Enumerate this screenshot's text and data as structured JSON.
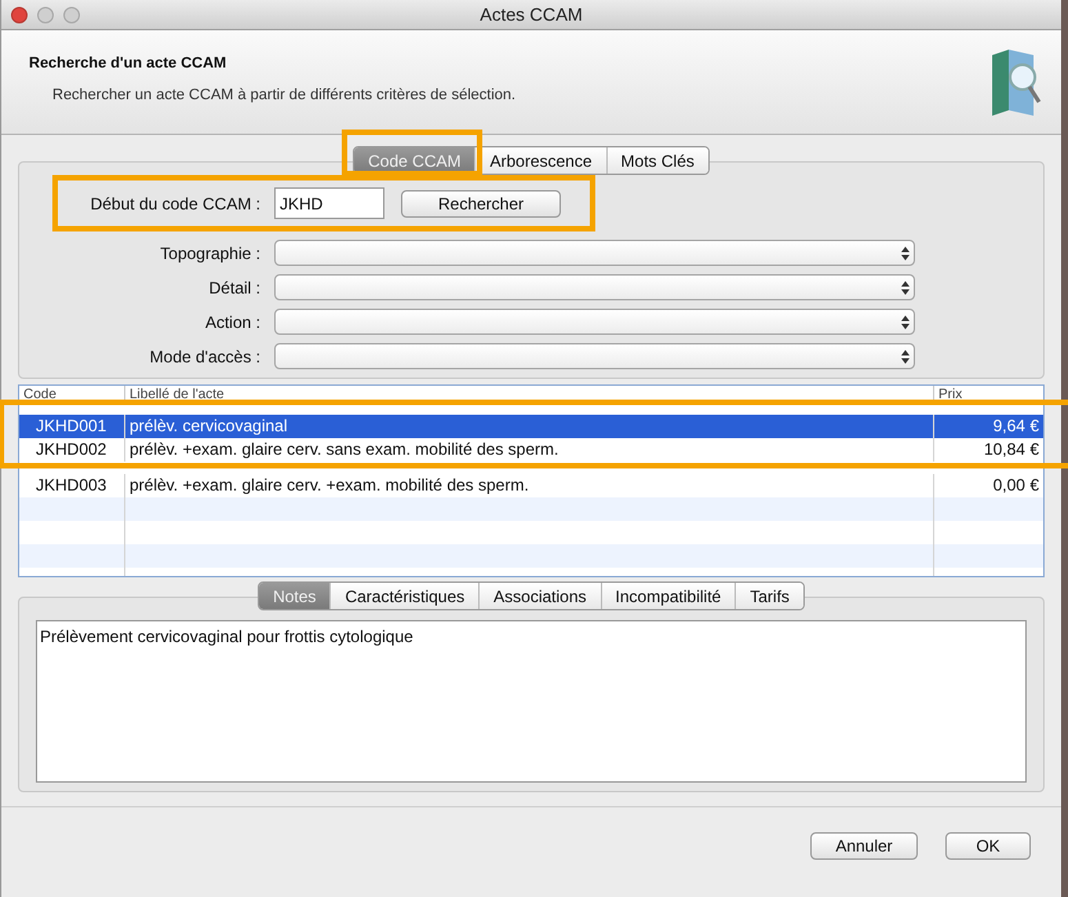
{
  "window": {
    "title": "Actes CCAM"
  },
  "header": {
    "title": "Recherche d'un acte CCAM",
    "subtitle": "Rechercher un acte CCAM à partir de différents critères de sélection."
  },
  "tabs": [
    {
      "label": "Code CCAM",
      "selected": true
    },
    {
      "label": "Arborescence",
      "selected": false
    },
    {
      "label": "Mots Clés",
      "selected": false
    }
  ],
  "form": {
    "code_label": "Début du code CCAM :",
    "code_value": "JKHD",
    "search_button": "Rechercher",
    "selects": [
      {
        "label": "Topographie :"
      },
      {
        "label": "Détail :"
      },
      {
        "label": "Action :"
      },
      {
        "label": "Mode d'accès :"
      }
    ]
  },
  "table": {
    "columns": [
      "Code",
      "Libellé de l'acte",
      "Prix"
    ],
    "rows": [
      {
        "code": "JKHD001",
        "label": "prélèv. cervicovaginal",
        "price": "9,64 €",
        "selected": true
      },
      {
        "code": "JKHD002",
        "label": "prélèv. +exam. glaire cerv. sans exam. mobilité des sperm.",
        "price": "10,84 €",
        "selected": false
      },
      {
        "code": "JKHD003",
        "label": "prélèv. +exam. glaire cerv. +exam. mobilité des sperm.",
        "price": "0,00 €",
        "selected": false
      }
    ]
  },
  "detail_tabs": [
    {
      "label": "Notes",
      "selected": true
    },
    {
      "label": "Caractéristiques",
      "selected": false
    },
    {
      "label": "Associations",
      "selected": false
    },
    {
      "label": "Incompatibilité",
      "selected": false
    },
    {
      "label": "Tarifs",
      "selected": false
    }
  ],
  "notes": "Prélèvement cervicovaginal pour frottis cytologique",
  "buttons": [
    "Annuler",
    "OK"
  ]
}
